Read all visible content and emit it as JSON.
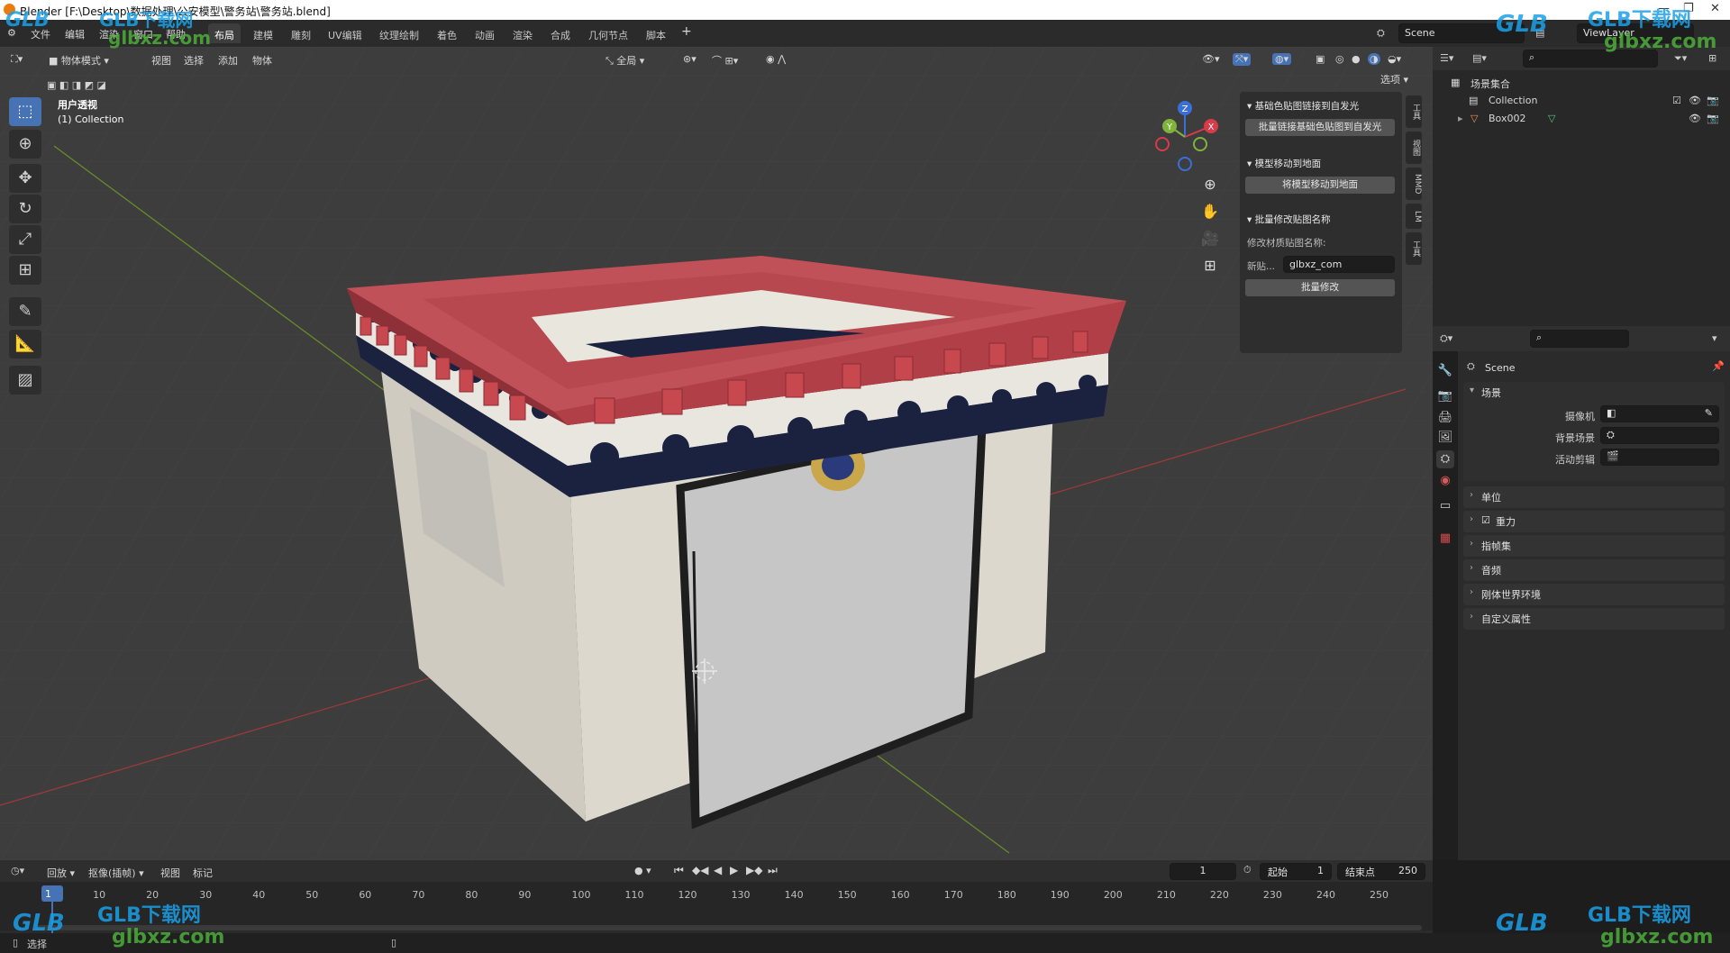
{
  "window": {
    "title": "Blender [F:\\Desktop\\数据处理\\公安模型\\警务站\\警务站.blend]"
  },
  "menu": [
    "文件",
    "编辑",
    "渲染",
    "窗口",
    "帮助"
  ],
  "workspaces": [
    "布局",
    "建模",
    "雕刻",
    "UV编辑",
    "纹理绘制",
    "着色",
    "动画",
    "渲染",
    "合成",
    "几何节点",
    "脚本"
  ],
  "active_workspace": "布局",
  "scene_field": "Scene",
  "viewlayer_field": "ViewLayer",
  "viewport_header": {
    "mode": "物体模式",
    "menus": [
      "视图",
      "选择",
      "添加",
      "物体"
    ],
    "transform_orientation": "全局",
    "options_label": "选项"
  },
  "viewport_overlay": {
    "view_name": "用户透视",
    "collection_label": "(1) Collection"
  },
  "gizmo_axes": {
    "x": "X",
    "y": "Y",
    "z": "Z"
  },
  "npanel": {
    "section1_title": "基础色贴图链接到自发光",
    "section1_button": "批量链接基础色贴图到自发光",
    "section2_title": "模型移动到地面",
    "section2_button": "将模型移动到地面",
    "section3_title": "批量修改贴图名称",
    "section3_label": "修改材质贴图名称:",
    "new_name_label": "新贴...",
    "new_name_value": "glbxz_com",
    "section3_button": "批量修改",
    "side_tabs": [
      "工具",
      "视图",
      "MMD",
      "LM",
      "工具"
    ]
  },
  "outliner": {
    "scene_collection": "场景集合",
    "items": [
      {
        "name": "Collection"
      },
      {
        "name": "Box002"
      }
    ]
  },
  "properties": {
    "scene_name": "Scene",
    "scene_section": "场景",
    "fields": [
      {
        "label": "摄像机"
      },
      {
        "label": "背景场景"
      },
      {
        "label": "活动剪辑"
      }
    ],
    "sections": [
      "单位",
      "重力",
      "指帧集",
      "音频",
      "刚体世界环境",
      "自定义属性"
    ]
  },
  "timeline": {
    "menus": [
      "回放",
      "抠像(插帧)",
      "视图",
      "标记"
    ],
    "current_frame": "1",
    "start_label": "起始",
    "start_value": "1",
    "end_label": "结束点",
    "end_value": "250",
    "frame_numbers": [
      "1",
      "10",
      "20",
      "30",
      "40",
      "50",
      "60",
      "70",
      "80",
      "90",
      "100",
      "110",
      "120",
      "130",
      "140",
      "150",
      "160",
      "170",
      "180",
      "190",
      "200",
      "210",
      "220",
      "230",
      "240",
      "250"
    ]
  },
  "statusbar": {
    "left": "选择"
  },
  "watermark": {
    "brand": "GLB下载网",
    "site": "glbxz.com",
    "logo": "GLB"
  },
  "colors": {
    "accent": "#4772b3",
    "roof_red": "#b8474d",
    "band_navy": "#1b2240",
    "wall": "#d2cec4"
  }
}
